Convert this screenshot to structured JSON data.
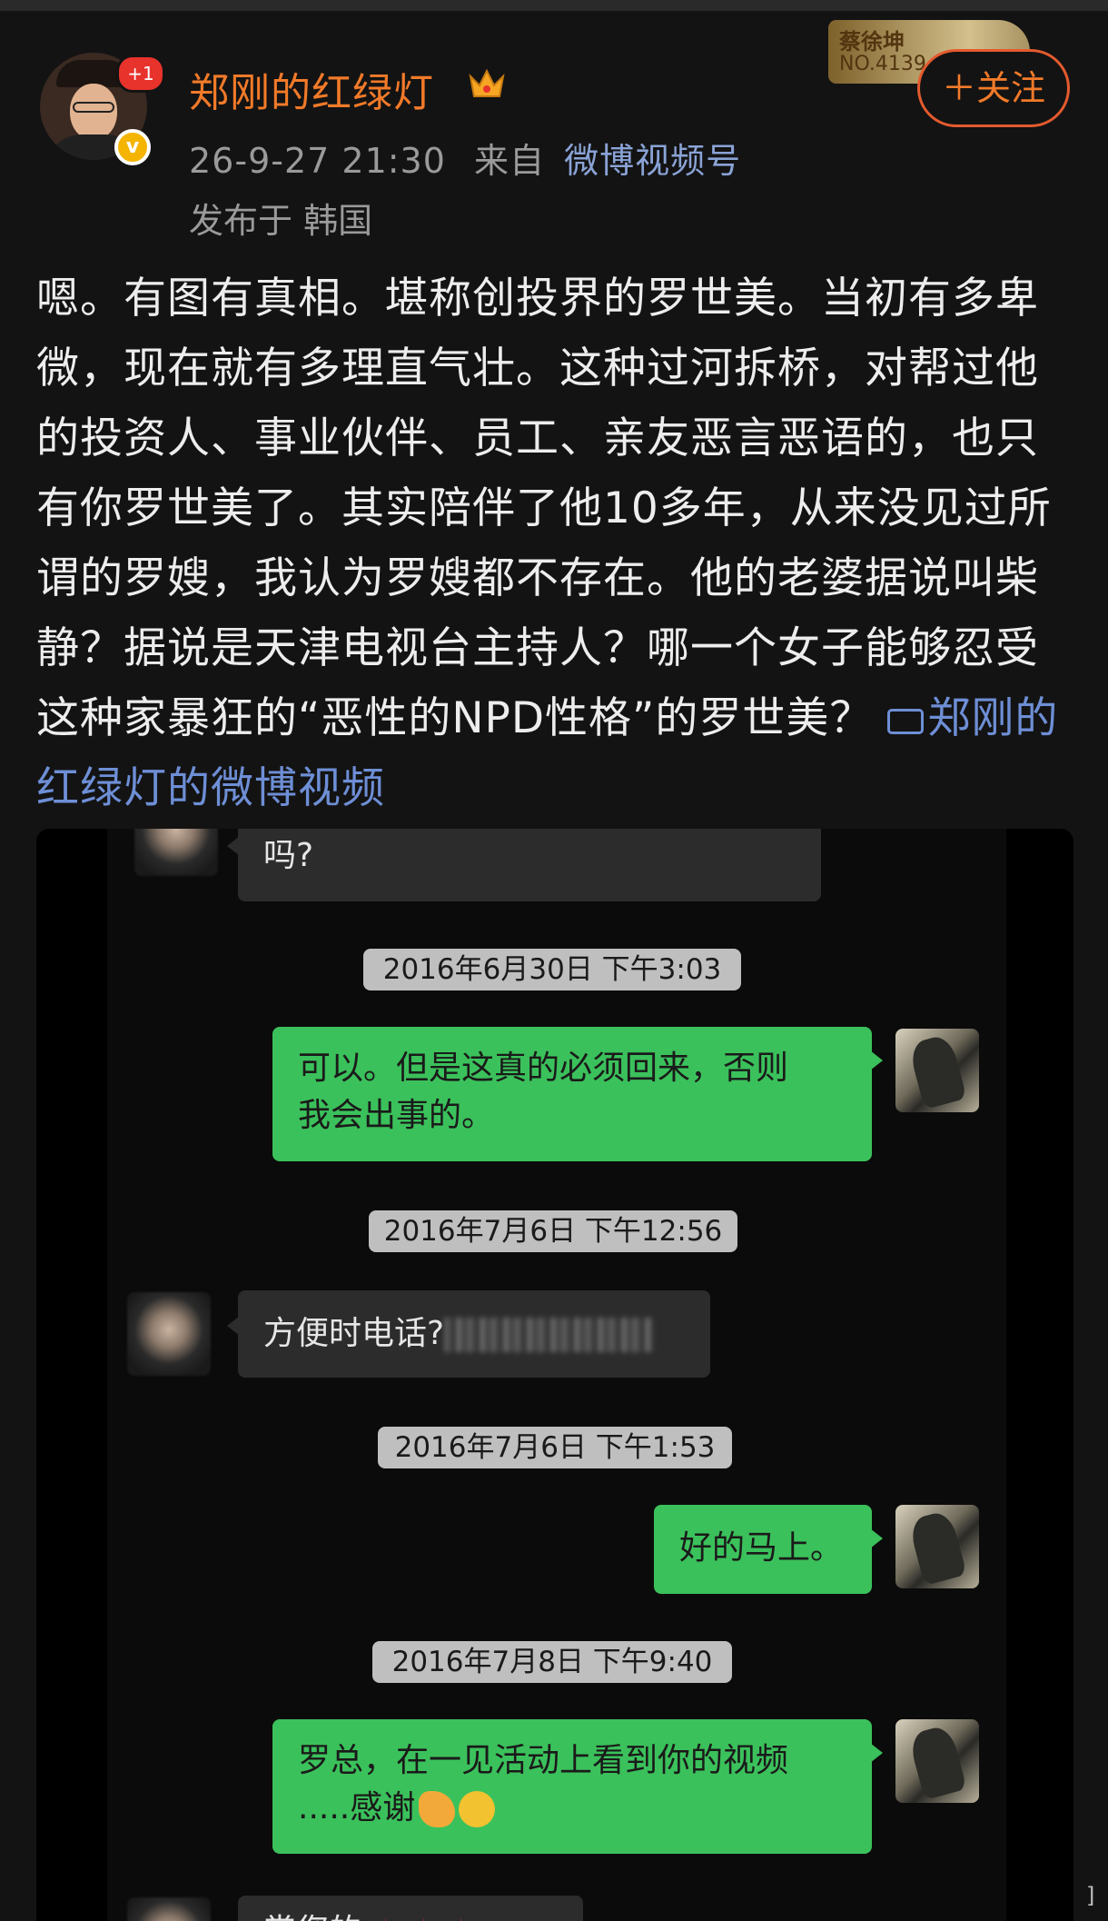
{
  "post": {
    "username": "郑刚的红绿灯",
    "avatar_badge": "+1",
    "verified_badge": "v",
    "date": "26-9-27 21:30",
    "from_label": "来自",
    "source": "微博视频号",
    "location": "发布于 韩国",
    "fan_badge_name": "蔡徐坤",
    "fan_badge_no": "NO.4139",
    "follow_label": "＋关注",
    "text": "嗯。有图有真相。堪称创投界的罗世美。当初有多卑微，现在就有多理直气壮。这种过河拆桥，对帮过他的投资人、事业伙伴、员工、亲友恶言恶语的，也只有你罗世美了。其实陪伴了他10多年，从来没见过所谓的罗嫂，我认为罗嫂都不存在。他的老婆据说叫柴静？据说是天津电视台主持人？哪一个女子能够忍受这种家暴狂的“恶性的NPD性格”的罗世美？ ",
    "video_link": "郑刚的红绿灯的微博视频"
  },
  "chat": {
    "msg0": "吗?",
    "ts1": "2016年6月30日 下午3:03",
    "msg1_line1": "可以。但是这真的必须回来，否则",
    "msg1_line2": "我会出事的。",
    "ts2": "2016年7月6日 下午12:56",
    "msg2": "方便时电话?",
    "ts3": "2016年7月6日 下午1:53",
    "msg3": "好的马上。",
    "ts4": "2016年7月8日 下午9:40",
    "msg4_line1": "罗总，在一见活动上看到你的视频",
    "msg4_line2": ".....感谢",
    "msg5": "赏您的"
  },
  "corner_mark": "]",
  "colors": {
    "username": "#f27a29",
    "link": "#6e8fd6",
    "out_bubble": "#3bc15b",
    "in_bubble": "#2c2c2c"
  }
}
